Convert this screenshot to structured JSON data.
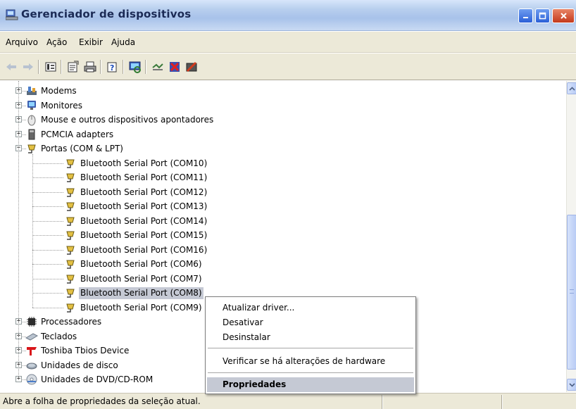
{
  "window": {
    "title": "Gerenciador de dispositivos",
    "buttons": [
      "minimize",
      "maximize",
      "close"
    ]
  },
  "menubar": {
    "items": [
      "Arquivo",
      "Ação",
      "Exibir",
      "Ajuda"
    ]
  },
  "toolbar": {
    "buttons": [
      "back-arrow-icon",
      "forward-arrow-icon",
      "view-icon",
      "properties-icon",
      "print-icon",
      "help-icon",
      "scan-hardware-icon",
      "update-driver-icon",
      "uninstall-icon",
      "disable-icon"
    ]
  },
  "tree": {
    "items": [
      {
        "label": "Modems",
        "icon": "modem-icon",
        "expander": "+"
      },
      {
        "label": "Monitores",
        "icon": "monitor-icon",
        "expander": "+"
      },
      {
        "label": "Mouse e outros dispositivos apontadores",
        "icon": "mouse-icon",
        "expander": "+"
      },
      {
        "label": "PCMCIA adapters",
        "icon": "pcmcia-icon",
        "expander": "+"
      },
      {
        "label": "Portas (COM & LPT)",
        "icon": "port-icon",
        "expander": "−"
      },
      {
        "label": "Bluetooth Serial Port (COM10)",
        "icon": "port-icon"
      },
      {
        "label": "Bluetooth Serial Port (COM11)",
        "icon": "port-icon"
      },
      {
        "label": "Bluetooth Serial Port (COM12)",
        "icon": "port-icon"
      },
      {
        "label": "Bluetooth Serial Port (COM13)",
        "icon": "port-icon"
      },
      {
        "label": "Bluetooth Serial Port (COM14)",
        "icon": "port-icon"
      },
      {
        "label": "Bluetooth Serial Port (COM15)",
        "icon": "port-icon"
      },
      {
        "label": "Bluetooth Serial Port (COM16)",
        "icon": "port-icon"
      },
      {
        "label": "Bluetooth Serial Port (COM6)",
        "icon": "port-icon"
      },
      {
        "label": "Bluetooth Serial Port (COM7)",
        "icon": "port-icon"
      },
      {
        "label": "Bluetooth Serial Port (COM8)",
        "icon": "port-icon",
        "selected": true
      },
      {
        "label": "Bluetooth Serial Port (COM9)",
        "icon": "port-icon"
      },
      {
        "label": "Processadores",
        "icon": "processor-icon",
        "expander": "+"
      },
      {
        "label": "Teclados",
        "icon": "keyboard-icon",
        "expander": "+"
      },
      {
        "label": "Toshiba Tbios Device",
        "icon": "toshiba-icon",
        "expander": "+"
      },
      {
        "label": "Unidades de disco",
        "icon": "disk-icon",
        "expander": "+"
      },
      {
        "label": "Unidades de DVD/CD-ROM",
        "icon": "dvd-icon",
        "expander": "+"
      }
    ]
  },
  "context_menu": {
    "items": [
      {
        "label": "Atualizar driver..."
      },
      {
        "label": "Desativar"
      },
      {
        "label": "Desinstalar"
      },
      {
        "label": "Verificar se há alterações de hardware"
      },
      {
        "label": "Propriedades",
        "bold": true
      }
    ]
  },
  "statusbar": {
    "text": "Abre a folha de propriedades da seleção atual."
  },
  "colors": {
    "selection": "#c5c9d4",
    "menubar": "#ece9d8",
    "titlebar": "#b8cfee"
  }
}
